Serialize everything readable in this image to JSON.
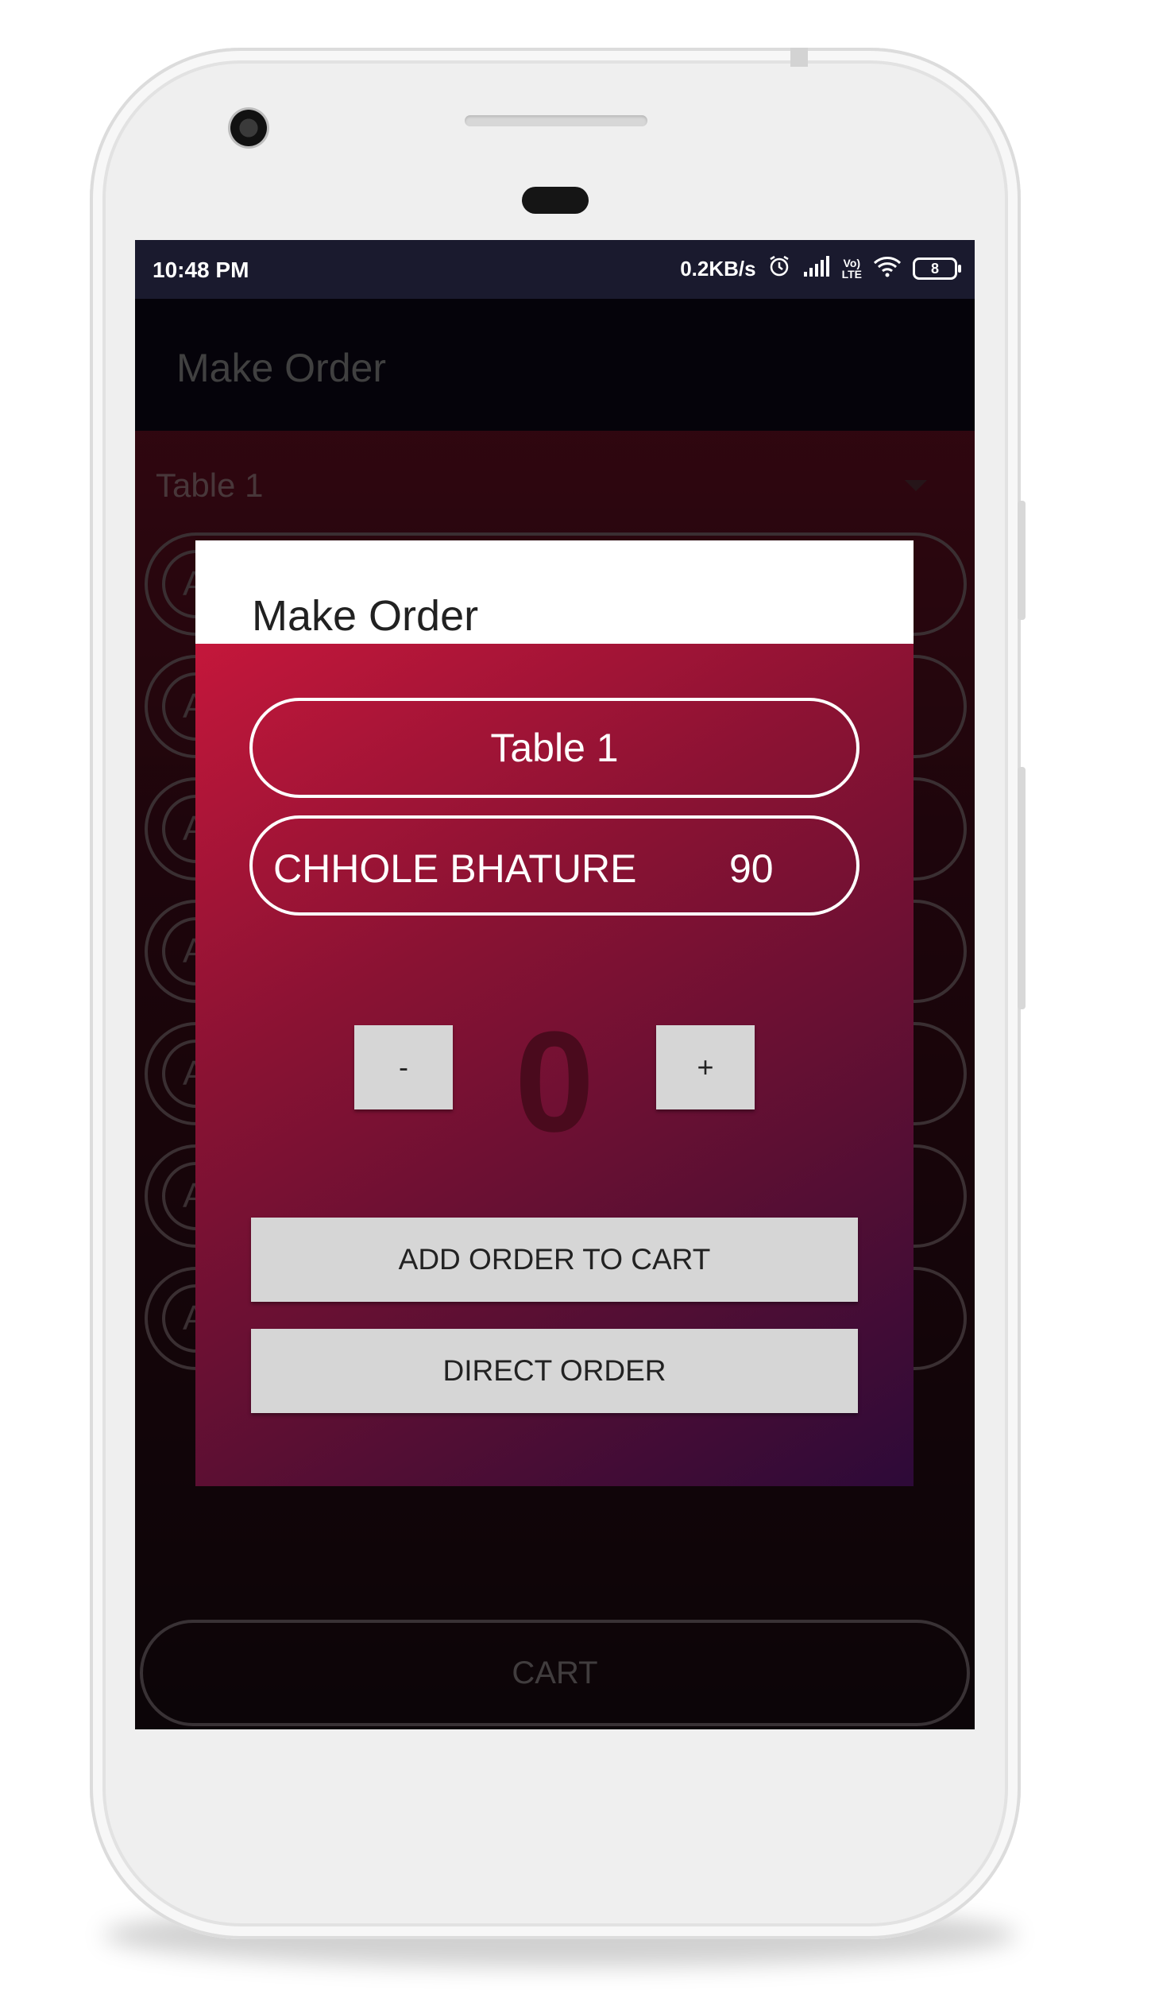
{
  "status_bar": {
    "time": "10:48 PM",
    "speed": "0.2KB/s",
    "battery": "8",
    "icons": [
      "alarm-icon",
      "signal-icon",
      "volte-icon",
      "wifi-icon",
      "battery-icon"
    ]
  },
  "app_bar": {
    "title": "Make Order"
  },
  "background": {
    "spinner_value": "Table 1",
    "list_items": [
      "A",
      "A",
      "A",
      "A",
      "A",
      "A",
      "A"
    ],
    "cart_label": "CART"
  },
  "dialog": {
    "title": "Make Order",
    "table": "Table 1",
    "item_name": "CHHOLE BHATURE",
    "item_price": "90",
    "minus_label": "-",
    "plus_label": "+",
    "quantity": "0",
    "add_to_cart_label": "ADD ORDER TO CART",
    "direct_order_label": "DIRECT ORDER"
  },
  "colors": {
    "dialog_gradient_start": "#c4173b",
    "dialog_gradient_end": "#2d0a38",
    "button_gray": "#d6d6d6",
    "status_bar": "#1a1a2e"
  }
}
